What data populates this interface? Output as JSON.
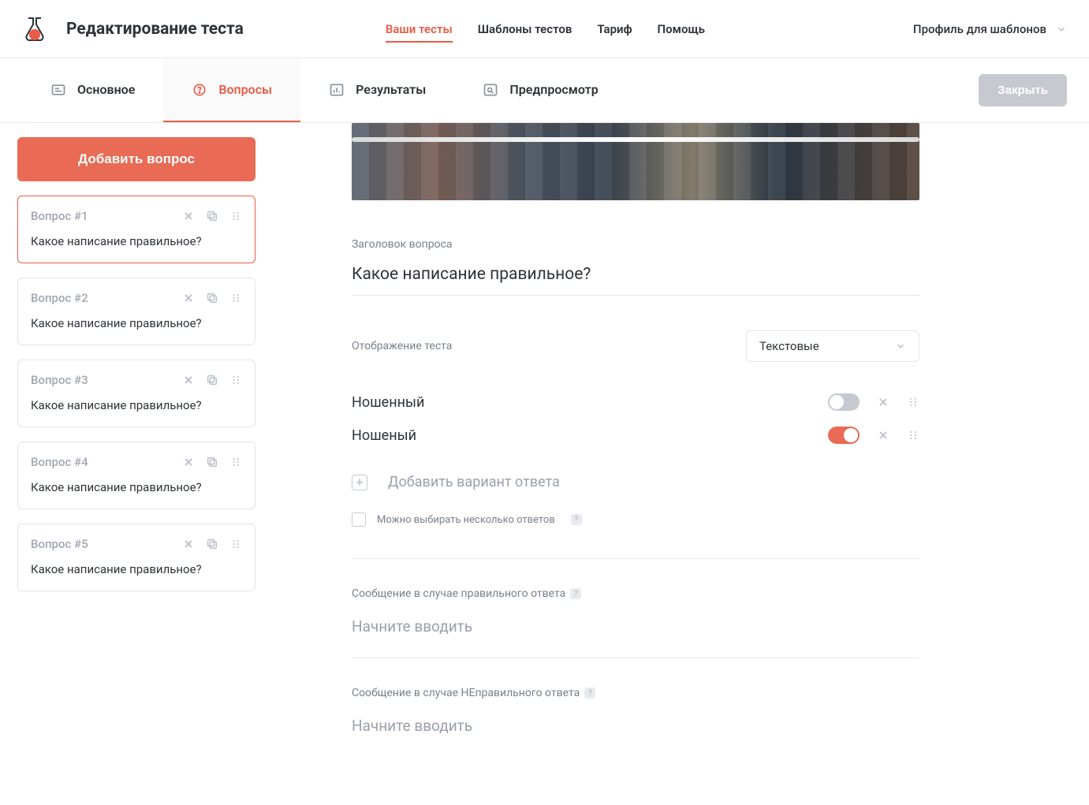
{
  "header": {
    "page_title": "Редактирование теста",
    "nav": [
      "Ваши тесты",
      "Шаблоны тестов",
      "Тариф",
      "Помощь"
    ],
    "active_nav_index": 0,
    "profile_label": "Профиль для шаблонов"
  },
  "tabs": {
    "items": [
      "Основное",
      "Вопросы",
      "Результаты",
      "Предпросмотр"
    ],
    "active_index": 1,
    "close_label": "Закрыть"
  },
  "sidebar": {
    "add_button": "Добавить вопрос",
    "questions": [
      {
        "num": "Вопрос #1",
        "text": "Какое написание правильное?"
      },
      {
        "num": "Вопрос #2",
        "text": "Какое написание правильное?"
      },
      {
        "num": "Вопрос #3",
        "text": "Какое написание правильное?"
      },
      {
        "num": "Вопрос #4",
        "text": "Какое написание правильное?"
      },
      {
        "num": "Вопрос #5",
        "text": "Какое написание правильное?"
      }
    ],
    "active_index": 0
  },
  "editor": {
    "title_label": "Заголовок вопроса",
    "title_value": "Какое написание правильное?",
    "display_label": "Отображение теста",
    "display_select_value": "Текстовые",
    "answers": [
      {
        "text": "Ношенный",
        "correct": false
      },
      {
        "text": "Ношеный",
        "correct": true
      }
    ],
    "add_answer_label": "Добавить вариант ответа",
    "multi_check_label": "Можно выбирать несколько ответов",
    "msg_correct_label": "Сообщение в случае правильного ответа",
    "msg_incorrect_label": "Сообщение в случае НЕправильного ответа",
    "msg_placeholder": "Начните вводить"
  }
}
